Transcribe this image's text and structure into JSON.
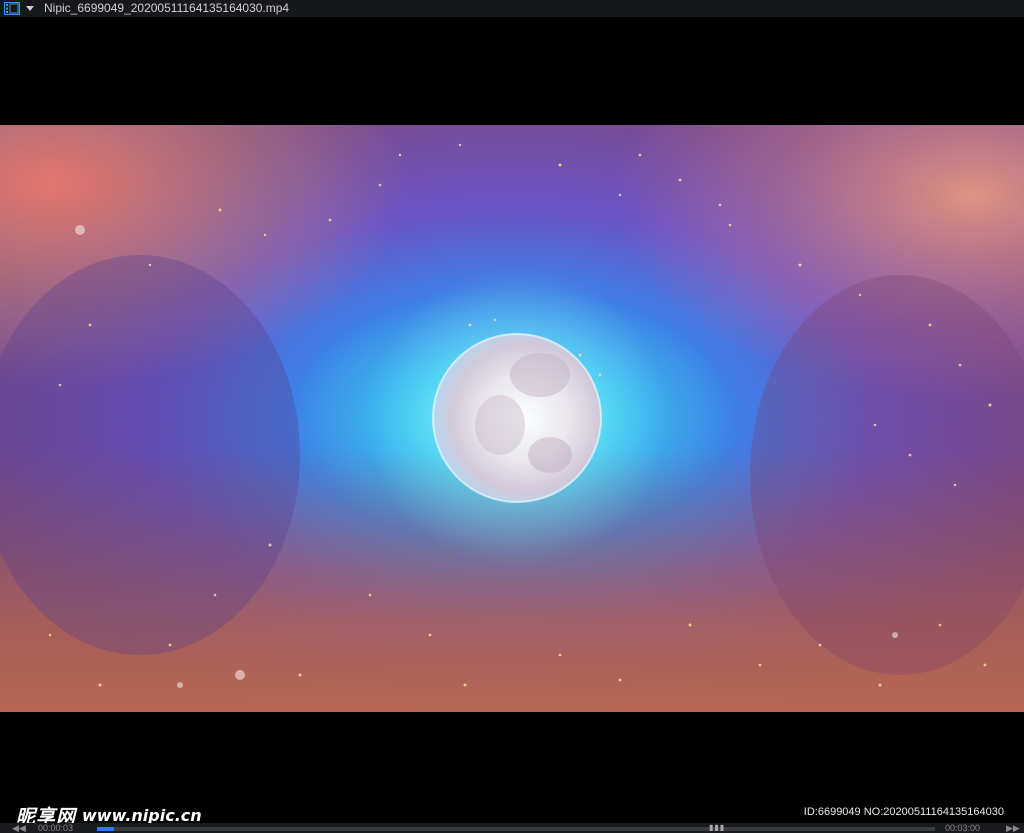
{
  "window": {
    "file_name": "Nipic_6699049_20200511164135164030.mp4"
  },
  "watermark": {
    "logo_text": "昵享网",
    "url": "www.nipic.cn",
    "id_line": "ID:6699049 NO:20200511164135164030"
  },
  "player": {
    "current_time": "00:00:03",
    "total_time": "00:03:00",
    "progress": 0.02,
    "colors": {
      "accent": "#2e7be6",
      "titlebar": "#17181b"
    }
  },
  "icons": {
    "film": "film-icon",
    "dropdown": "chevron-down-icon",
    "rewind": "rewind-icon",
    "forward": "fast-forward-icon"
  }
}
